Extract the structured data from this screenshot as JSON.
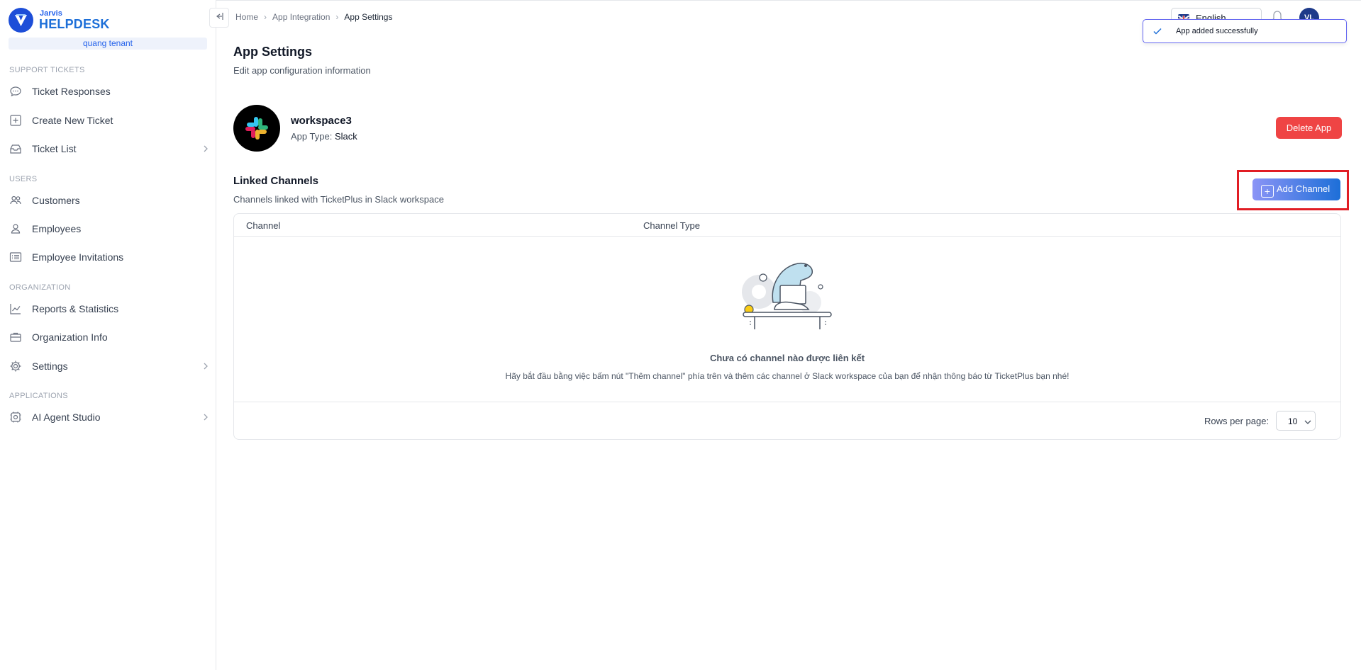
{
  "brand": {
    "small": "Jarvis",
    "big": "HELPDESK",
    "tenant": "quang tenant"
  },
  "sidebar": {
    "sections": [
      {
        "label": "SUPPORT TICKETS"
      },
      {
        "label": "USERS"
      },
      {
        "label": "ORGANIZATION"
      },
      {
        "label": "APPLICATIONS"
      }
    ],
    "items": [
      {
        "label": "Ticket Responses",
        "icon": "chat-bubble-icon"
      },
      {
        "label": "Create New Ticket",
        "icon": "plus-square-icon"
      },
      {
        "label": "Ticket List",
        "icon": "inbox-icon"
      },
      {
        "label": "Customers",
        "icon": "users-icon"
      },
      {
        "label": "Employees",
        "icon": "user-icon"
      },
      {
        "label": "Employee Invitations",
        "icon": "list-icon"
      },
      {
        "label": "Reports & Statistics",
        "icon": "chart-line-icon"
      },
      {
        "label": "Organization Info",
        "icon": "briefcase-icon"
      },
      {
        "label": "Settings",
        "icon": "gear-icon"
      },
      {
        "label": "AI Agent Studio",
        "icon": "chip-icon"
      }
    ]
  },
  "breadcrumb": {
    "home": "Home",
    "integration": "App Integration",
    "current": "App Settings"
  },
  "header": {
    "title": "App Settings",
    "subtitle": "Edit app configuration information"
  },
  "app": {
    "name": "workspace3",
    "type_label": "App Type:",
    "type_value": "Slack",
    "delete_label": "Delete App"
  },
  "linked": {
    "title": "Linked Channels",
    "subtitle": "Channels linked with TicketPlus in Slack workspace",
    "add_label": "Add Channel"
  },
  "table": {
    "columns": [
      "Channel",
      "Channel Type"
    ],
    "empty_title": "Chưa có channel nào được liên kết",
    "empty_sub": "Hãy bắt đầu bằng việc bấm nút \"Thêm channel\" phía trên và thêm các channel ở Slack workspace của bạn để nhận thông báo từ TicketPlus bạn nhé!",
    "rows_label": "Rows per page:",
    "rows_value": "10"
  },
  "topbar": {
    "language": "English",
    "avatar": "VL"
  },
  "toast": {
    "message": "App added successfully"
  },
  "colors": {
    "accent": "#1d6fd8",
    "danger": "#ef4444",
    "highlight": "#e11d24"
  }
}
